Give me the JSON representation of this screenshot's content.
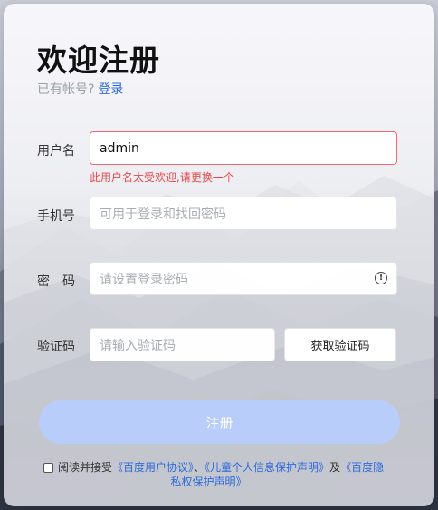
{
  "title": "欢迎注册",
  "subline": {
    "text": "已有帐号?",
    "login_link": "登录"
  },
  "username": {
    "label": "用户名",
    "value": "admin",
    "error": "此用户名太受欢迎,请更换一个"
  },
  "phone": {
    "label": "手机号",
    "placeholder": "可用于登录和找回密码"
  },
  "password": {
    "label": "密　码",
    "placeholder": "请设置登录密码",
    "icon": "info-icon"
  },
  "code": {
    "label": "验证码",
    "placeholder": "请输入验证码",
    "button": "获取验证码"
  },
  "submit_label": "注册",
  "agreement": {
    "prefix": "阅读并接受",
    "link1": "《百度用户协议》",
    "sep": "、",
    "link2": "《儿童个人信息保护声明》",
    "conj": "及",
    "link3a": "《百度隐",
    "link3b": "私权保护声明》"
  },
  "colors": {
    "accent": "#2f6bdc",
    "error": "#e84848",
    "submit_disabled": "#b9cdfb"
  }
}
